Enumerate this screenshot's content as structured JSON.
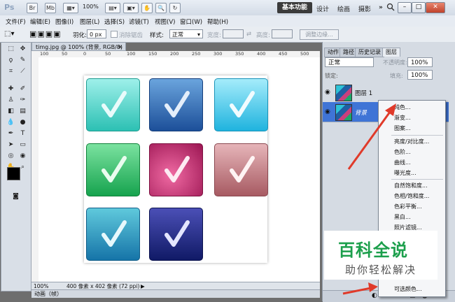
{
  "titlebar": {
    "app_logo": "Ps",
    "icons": [
      "Br",
      "Mb"
    ],
    "zoom": "100%",
    "workspace_active": "基本功能",
    "workspaces": [
      "设计",
      "绘画",
      "摄影"
    ],
    "more": "»"
  },
  "menu": [
    "文件(F)",
    "编辑(E)",
    "图像(I)",
    "图层(L)",
    "选择(S)",
    "滤镜(T)",
    "视图(V)",
    "窗口(W)",
    "帮助(H)"
  ],
  "options": {
    "feather_label": "羽化:",
    "feather_value": "0 px",
    "antialias_label": "消除锯齿",
    "style_label": "样式:",
    "style_value": "正常",
    "width_label": "宽度:",
    "height_label": "高度:",
    "adjust_edge": "调整边缘..."
  },
  "document": {
    "tab_title": "timg.jpg @ 100% (背景, RGB/8) *",
    "ruler_ticks": [
      "100",
      "50",
      "0",
      "50",
      "100",
      "150",
      "200",
      "250",
      "300",
      "350",
      "400",
      "450",
      "500"
    ],
    "status_zoom": "100%",
    "status_info": "400 像素 x 402 像素 (72 ppi)",
    "anim_panel": "动画（帧）"
  },
  "panel": {
    "tabs": [
      "动作",
      "路径",
      "历史记录",
      "图层"
    ],
    "blend_mode": "正常",
    "opacity_label": "不透明度:",
    "opacity_value": "100%",
    "lock_label": "锁定:",
    "fill_label": "填充:",
    "fill_value": "100%",
    "layers": [
      {
        "name": "图层 1",
        "selected": false
      },
      {
        "name": "背景",
        "selected": true
      }
    ]
  },
  "context_menu": {
    "items_a": [
      "纯色...",
      "渐变...",
      "图案..."
    ],
    "items_b": [
      "亮度/对比度...",
      "色阶...",
      "曲线...",
      "曝光度..."
    ],
    "items_c": [
      "自然饱和度...",
      "色相/饱和度...",
      "色彩平衡...",
      "黑白...",
      "照片滤镜..."
    ],
    "last_item": "可选颜色..."
  },
  "watermark": {
    "title": "百科全说",
    "subtitle": "助你轻松解决"
  },
  "colors": {
    "accent_arrow": "#e03a2a",
    "selected_layer": "#3f74d6",
    "watermark_green": "#1c9f4c"
  }
}
